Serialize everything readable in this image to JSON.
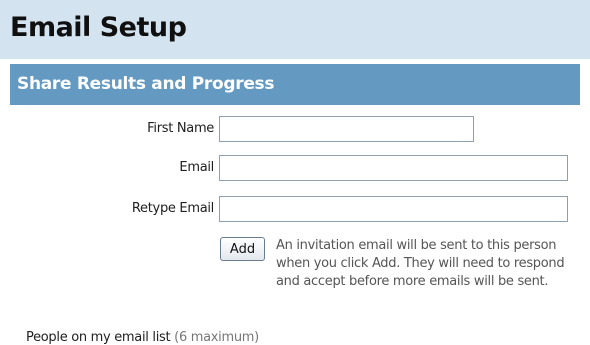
{
  "page": {
    "title": "Email Setup"
  },
  "section": {
    "title": "Share Results and Progress"
  },
  "form": {
    "first_name_label": "First Name",
    "first_name_value": "",
    "email_label": "Email",
    "email_value": "",
    "retype_email_label": "Retype Email",
    "retype_email_value": "",
    "add_button_label": "Add",
    "help_text": "An invitation email will be sent to this person when you click Add. They will need to respond and accept before more emails will be sent."
  },
  "email_list": {
    "heading": "People on my email list",
    "limit_note": "(6 maximum)"
  }
}
